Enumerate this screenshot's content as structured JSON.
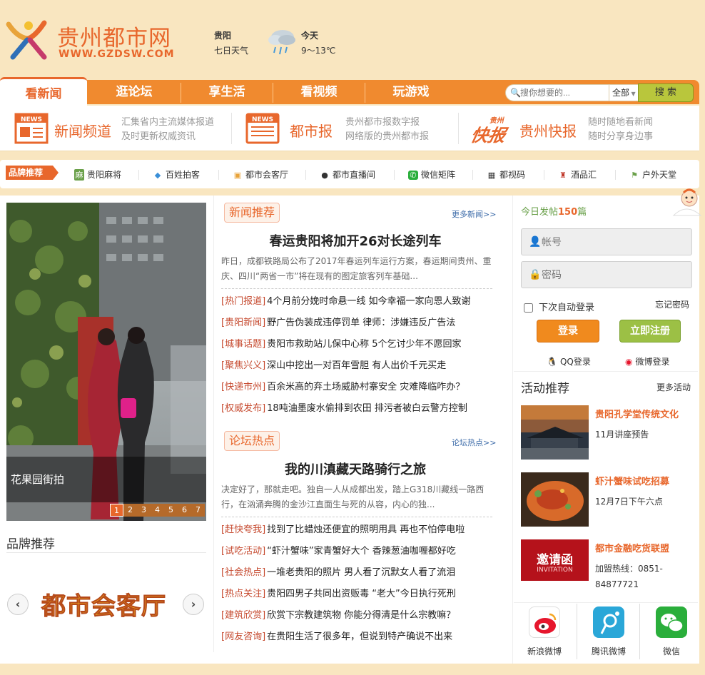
{
  "header": {
    "logo_cn": "贵州都市网",
    "logo_en": "WWW.GZDSW.COM",
    "city": "贵阳",
    "forecast_label": "七日天气",
    "today_label": "今天",
    "temperature": "9～13℃"
  },
  "nav": {
    "tabs": [
      {
        "label": "看新闻",
        "active": true
      },
      {
        "label": "逛论坛",
        "active": false
      },
      {
        "label": "享生活",
        "active": false
      },
      {
        "label": "看视频",
        "active": false
      },
      {
        "label": "玩游戏",
        "active": false
      }
    ],
    "search_placeholder": "搜你想要的...",
    "search_scope": "全部",
    "search_button": "搜 索"
  },
  "channels": [
    {
      "title": "新闻频道",
      "desc1": "汇集省内主流媒体报道",
      "desc2": "及时更新权威资讯",
      "icon": "news-icon"
    },
    {
      "title": "都市报",
      "desc1": "贵州都市报数字报",
      "desc2": "网络版的贵州都市报",
      "icon": "newspaper-icon"
    },
    {
      "title": "贵州快报",
      "desc1": "随时随地看新闻",
      "desc2": "随时分享身边事",
      "icon": "kuaibao-logo",
      "logo_text_top": "贵州",
      "logo_text_main": "快报"
    }
  ],
  "brand_bar": {
    "tag": "品牌推荐",
    "items": [
      {
        "label": "贵阳麻将",
        "icon": "mahjong-icon"
      },
      {
        "label": "百姓拍客",
        "icon": "diamond-icon"
      },
      {
        "label": "都市会客厅",
        "icon": "parlor-icon"
      },
      {
        "label": "都市直播间",
        "icon": "camera-icon"
      },
      {
        "label": "微信矩阵",
        "icon": "wechat-icon"
      },
      {
        "label": "都视码",
        "icon": "qrcode-icon"
      },
      {
        "label": "酒品汇",
        "icon": "wine-icon"
      },
      {
        "label": "户外天堂",
        "icon": "flag-icon"
      }
    ]
  },
  "slideshow": {
    "caption": "花果园街拍",
    "pages": [
      "1",
      "2",
      "3",
      "4",
      "5",
      "6",
      "7"
    ],
    "active_page": 1
  },
  "brand_panel": {
    "title": "品牌推荐",
    "logo_text": "都市会客厅"
  },
  "news": {
    "section": "新闻推荐",
    "more": "更多新闻>>",
    "headline": "春运贵阳将加开26对长途列车",
    "summary": "昨日，成都铁路局公布了2017年春运列车运行方案，春运期间贵州、重庆、四川“两省一市”将在现有的图定旅客列车基础...",
    "items": [
      {
        "tag": "[热门报道]",
        "text": "4个月前分娩时命悬一线 如今幸福一家向恩人致谢"
      },
      {
        "tag": "[贵阳新闻]",
        "text": "野广告伪装成违停罚单 律师：涉嫌违反广告法"
      },
      {
        "tag": "[城事话题]",
        "text": "贵阳市救助站儿保中心称 5个乞讨少年不愿回家"
      },
      {
        "tag": "[聚焦兴义]",
        "text": "深山中挖出一对百年雪胆 有人出价千元买走"
      },
      {
        "tag": "[快递市州]",
        "text": "百余米高的弃土场威胁村寨安全 灾难降临咋办？"
      },
      {
        "tag": "[权威发布]",
        "text": "18吨油墨废水偷排到农田 排污者被白云警方控制"
      }
    ]
  },
  "forum": {
    "section": "论坛热点",
    "more": "论坛热点>>",
    "headline": "我的川滇藏天路骑行之旅",
    "summary": "决定好了，那就走吧。独自一人从成都出发，踏上G318川藏线一路西行，在汹涌奔腾的金沙江直面生与死的从容，内心的独...",
    "items": [
      {
        "tag": "[赶快夸我]",
        "text": "找到了比蜡烛还便宜的照明用具 再也不怕停电啦"
      },
      {
        "tag": "[试吃活动]",
        "text": "“虾汁蟹味”家青蟹好大个 香辣葱油咖喱都好吃"
      },
      {
        "tag": "[社会热点]",
        "text": "一堆老贵阳的照片 男人看了沉默女人看了流泪"
      },
      {
        "tag": "[热点关注]",
        "text": "贵阳四男子共同出资贩毒 “老大”今日执行死刑"
      },
      {
        "tag": "[建筑欣赏]",
        "text": "欣赏下宗教建筑物 你能分得清是什么宗教嘛？"
      },
      {
        "tag": "[网友咨询]",
        "text": "在贵阳生活了很多年，但说到特产确说不出来"
      }
    ]
  },
  "login": {
    "today_prefix": "今日发帖",
    "today_count": "150",
    "today_suffix": "篇",
    "username_placeholder": "帐号",
    "password_placeholder": "密码",
    "remember_label": "下次自动登录",
    "forgot_label": "忘记密码",
    "login_button": "登录",
    "register_button": "立即注册",
    "qq_login": "QQ登录",
    "weibo_login": "微博登录"
  },
  "activities": {
    "title": "活动推荐",
    "more": "更多活动",
    "items": [
      {
        "title": "贵阳孔学堂传统文化",
        "desc": "11月讲座预告"
      },
      {
        "title": "虾汁蟹味试吃招募",
        "desc": "12月7日下午六点"
      },
      {
        "title": "都市金融吃货联盟",
        "desc": "加盟热线：0851-84877721",
        "img_text": "邀请函",
        "img_sub": "INVITATION"
      }
    ]
  },
  "sns": [
    {
      "label": "新浪微博",
      "icon": "sina-weibo-icon"
    },
    {
      "label": "腾讯微博",
      "icon": "tencent-weibo-icon"
    },
    {
      "label": "微信",
      "icon": "wechat-icon"
    }
  ],
  "colors": {
    "background": "#f9e6c0",
    "accent": "#e8672c",
    "nav": "#f08a2f",
    "register": "#9cc045"
  }
}
